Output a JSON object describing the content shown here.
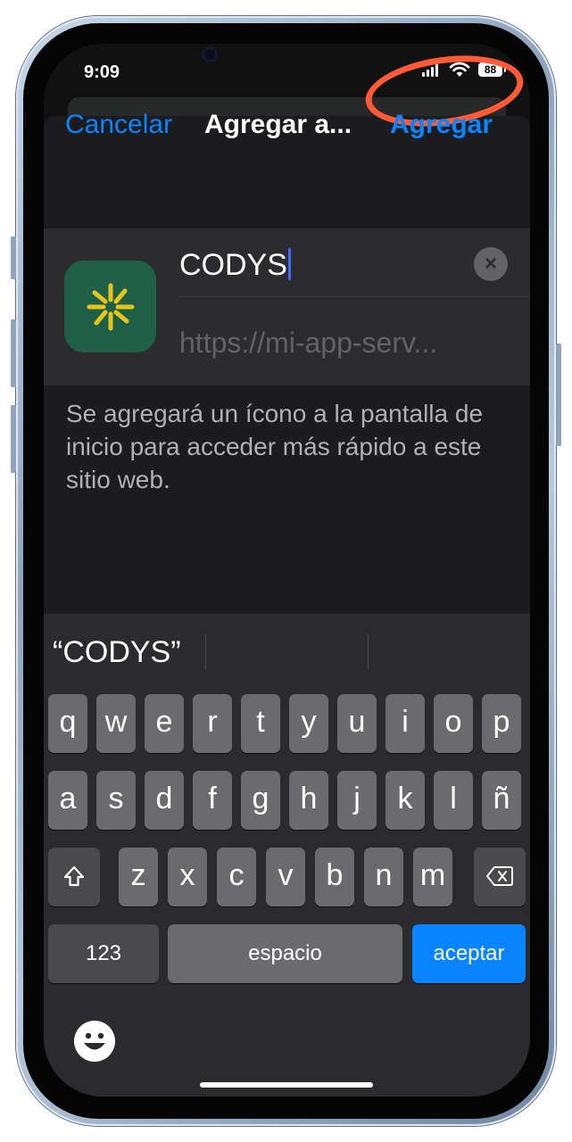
{
  "status_bar": {
    "time": "9:09",
    "battery": "88"
  },
  "nav": {
    "cancel": "Cancelar",
    "title": "Agregar a...",
    "add": "Agregar"
  },
  "form": {
    "name_value": "CODYS",
    "url": "https://mi-app-serv..."
  },
  "help_text": "Se agregará un ícono a la pantalla de inicio para acceder más rápido a este sitio web.",
  "keyboard": {
    "suggestion": "“CODYS”",
    "row1": [
      "q",
      "w",
      "e",
      "r",
      "t",
      "y",
      "u",
      "i",
      "o",
      "p"
    ],
    "row2": [
      "a",
      "s",
      "d",
      "f",
      "g",
      "h",
      "j",
      "k",
      "l",
      "ñ"
    ],
    "row3": [
      "z",
      "x",
      "c",
      "v",
      "b",
      "n",
      "m"
    ],
    "numbers_label": "123",
    "space_label": "espacio",
    "return_label": "aceptar"
  },
  "colors": {
    "accent": "#0a84ff",
    "annotation": "#ff5a36",
    "app_icon_bg": "#1f5f48",
    "app_icon_fg": "#e8c619"
  },
  "icons": [
    "signal-icon",
    "wifi-icon",
    "battery-icon",
    "clear-icon",
    "shift-icon",
    "delete-icon",
    "emoji-icon",
    "app-icon"
  ]
}
